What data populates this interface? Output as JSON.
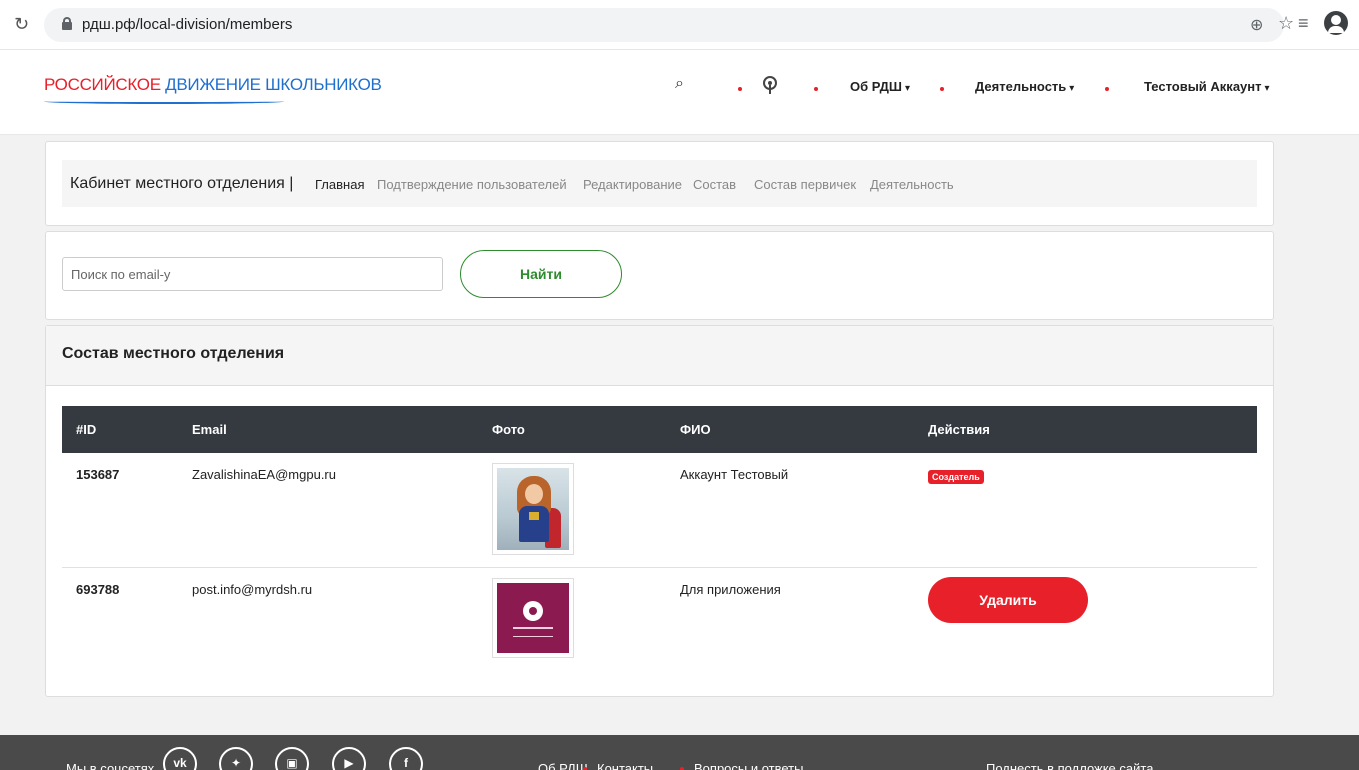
{
  "browser": {
    "url": "рдш.рф/local-division/members"
  },
  "header": {
    "logo_part1": "Российское",
    "logo_part2": "Движение школьников",
    "nav": {
      "about": "Об РДШ",
      "activity": "Деятельность",
      "account": "Тестовый Аккаунт"
    }
  },
  "tabs": {
    "title": "Кабинет местного отделения |",
    "items": [
      {
        "label": "Главная",
        "active": true
      },
      {
        "label": "Подтверждение пользователей",
        "active": false
      },
      {
        "label": "Редактирование",
        "active": false
      },
      {
        "label": "Состав",
        "active": false
      },
      {
        "label": "Состав первичек",
        "active": false
      },
      {
        "label": "Деятельность",
        "active": false
      }
    ]
  },
  "search": {
    "placeholder": "Поиск по email-у",
    "value": "",
    "button_label": "Найти"
  },
  "members": {
    "title": "Состав местного отделения",
    "columns": [
      "#ID",
      "Email",
      "Фото",
      "ФИО",
      "Действия"
    ],
    "rows": [
      {
        "id": "153687",
        "email": "ZavalishinaEA@mgpu.ru",
        "name": "Аккаунт Тестовый",
        "action": "Создатель"
      },
      {
        "id": "693788",
        "email": "post.info@myrdsh.ru",
        "name": "Для приложения",
        "action": "Удалить"
      }
    ]
  },
  "footer": {
    "social_label": "Мы в соцсетях",
    "social_icons": [
      "vk",
      "twitter",
      "instagram",
      "youtube",
      "facebook"
    ],
    "links": [
      "Об РДШ",
      "Контакты",
      "Вопросы и ответы"
    ],
    "right_text": "Поднесть в подложке сайта"
  },
  "colors": {
    "accent_red": "#e8202a",
    "accent_blue": "#1f6fce",
    "accent_green": "#2e8b2e",
    "table_head": "#343a40"
  }
}
